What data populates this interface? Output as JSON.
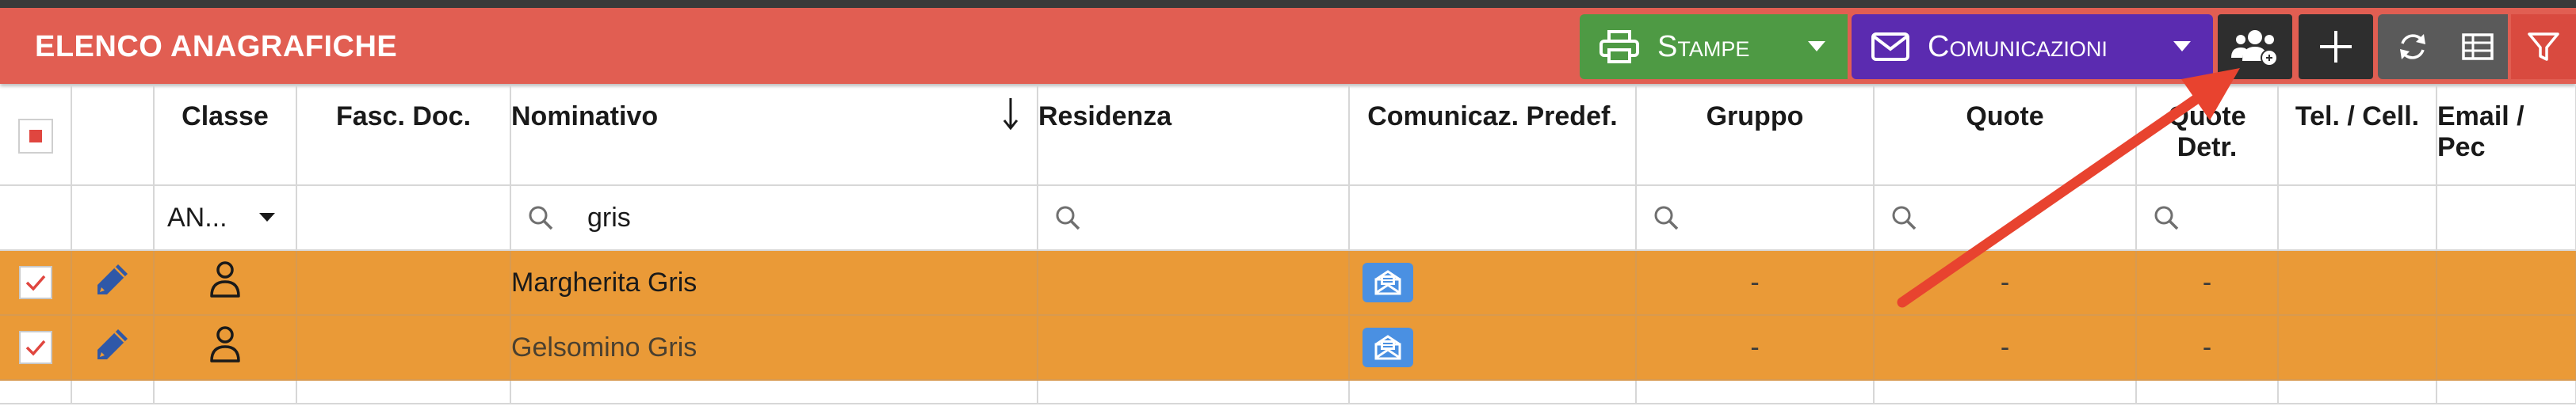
{
  "header": {
    "title": "ELENCO ANAGRAFICHE",
    "buttons": {
      "stampe": "Stampe",
      "comunicazioni": "Comunicazioni"
    }
  },
  "columns": {
    "classe": "Classe",
    "fasc_doc": "Fasc. Doc.",
    "nominativo": "Nominativo",
    "residenza": "Residenza",
    "comunicaz": "Comunicaz. Predef.",
    "gruppo": "Gruppo",
    "quote": "Quote",
    "quote_detr_1": "Quote",
    "quote_detr_2": "Detr.",
    "tel": "Tel. / Cell.",
    "email_1": "Email /",
    "email_2": "Pec"
  },
  "filters": {
    "classe_value": "AN...",
    "nominativo_value": "gris"
  },
  "rows": [
    {
      "nominativo": "Margherita Gris",
      "gruppo": "-",
      "quote": "-",
      "quote_detr": "-",
      "checked": true
    },
    {
      "nominativo": "Gelsomino Gris",
      "gruppo": "-",
      "quote": "-",
      "quote_detr": "-",
      "checked": true
    }
  ],
  "colors": {
    "header_bg": "#e15e52",
    "stampe_bg": "#4e9a44",
    "comunicazioni_bg": "#5b2bb0",
    "row_selected_bg": "#ea9a37",
    "annotation_arrow": "#e8432f"
  }
}
